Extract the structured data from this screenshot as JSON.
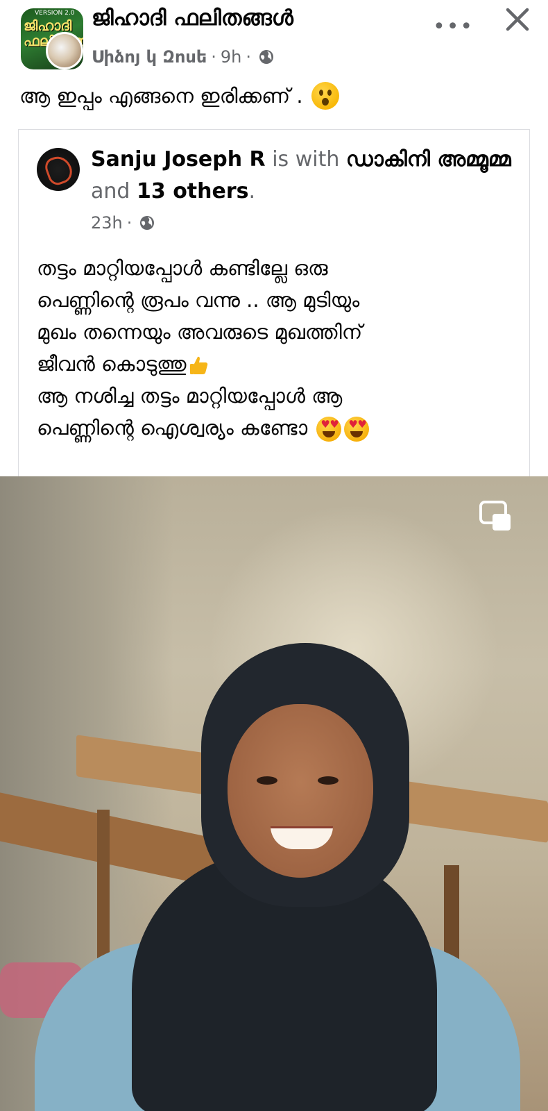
{
  "post": {
    "group_name": "ജിഹാദി ഫലിതങ്ങൾ",
    "group_avatar_text": "ജിഹാദി ഫലിതങ്ങൾ",
    "group_avatar_version": "VERSION 2.0",
    "author": "Սիձոյ կ Զոսե",
    "time": "9h",
    "separator": "·",
    "more_icon": "•••",
    "text": "ആ ഇപ്പം എങ്ങനെ ഇരിക്കണ് ."
  },
  "shared": {
    "author": "Sanju Joseph R",
    "with_text": "is with",
    "tagged": "ഡാകിനി അമ്മൂമ്മ",
    "and_text": "and",
    "others": "13 others",
    "period": ".",
    "time": "23h",
    "separator": "·",
    "lines": [
      "തട്ടം മാറ്റിയപ്പോൾ കണ്ടില്ലേ ഒരു",
      "പെണ്ണിന്റെ രൂപം വന്നു .. ആ മുടിയും",
      "മുഖം തന്നെയും അവരുടെ മുഖത്തിന്",
      "ജീവൻ കൊടുത്തു",
      "ആ നശിച്ച തട്ടം മാറ്റിയപ്പോൾ ആ",
      "പെണ്ണിന്റെ ഐശ്വര്യം കണ്ടോ"
    ]
  },
  "icons": {
    "globe": "globe-icon",
    "close": "close-icon",
    "more": "more-options-icon",
    "pip": "picture-in-picture-icon",
    "thumbs_up": "thumbs-up-emoji",
    "heart_eyes": "heart-eyes-emoji",
    "surprised": "surprised-face-emoji"
  }
}
